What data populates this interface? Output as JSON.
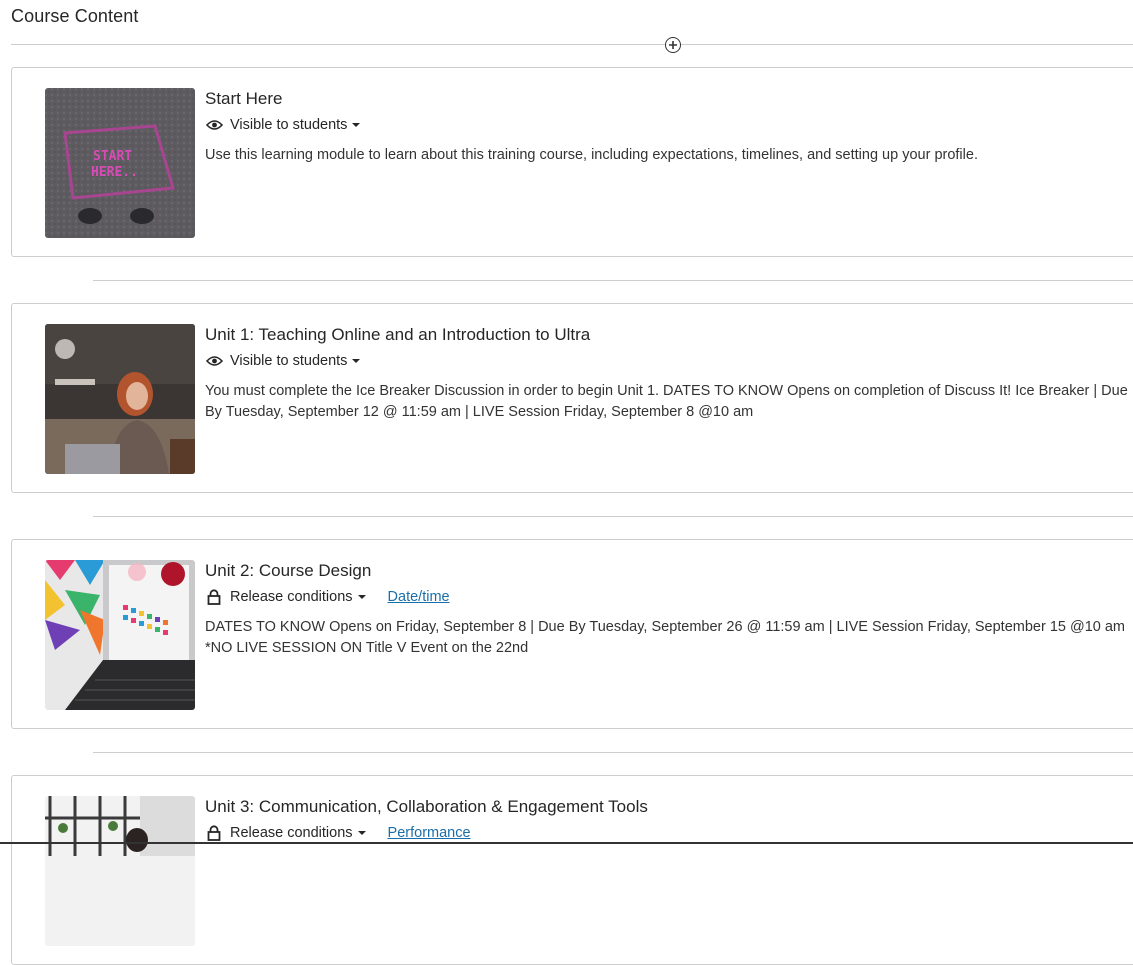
{
  "page": {
    "title": "Course Content"
  },
  "items": [
    {
      "title": "Start Here",
      "status": "Visible to students",
      "status_icon": "eye-icon",
      "link": "",
      "description": "Use this learning module to learn about this training course, including expectations, timelines, and setting up your profile."
    },
    {
      "title": "Unit 1: Teaching Online and an Introduction to Ultra",
      "status": "Visible to students",
      "status_icon": "eye-icon",
      "link": "",
      "description": "You must complete the Ice Breaker Discussion in order to begin Unit 1. DATES TO KNOW Opens on completion of Discuss It! Ice Breaker | Due By Tuesday, September 12 @ 11:59 am | LIVE Session Friday, September 8 @10 am"
    },
    {
      "title": "Unit 2: Course Design",
      "status": "Release conditions",
      "status_icon": "lock-icon",
      "link": "Date/time",
      "description": "DATES TO KNOW Opens on Friday, September 8 | Due By Tuesday, September 26 @ 11:59 am | LIVE Session Friday, September 15 @10 am *NO LIVE SESSION ON Title V Event on the 22nd"
    },
    {
      "title": "Unit 3: Communication, Collaboration & Engagement Tools",
      "status": "Release conditions",
      "status_icon": "lock-icon",
      "link": "Performance",
      "description": ""
    }
  ],
  "colors": {
    "link": "#1b6fa8",
    "border": "#cdcdcd",
    "text": "#262626"
  }
}
